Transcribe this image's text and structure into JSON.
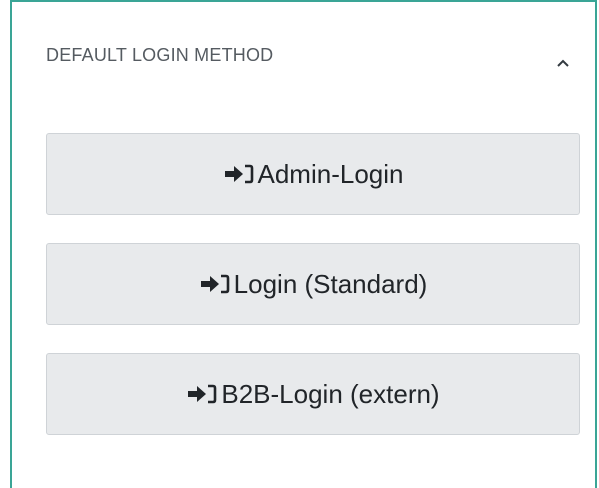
{
  "panel": {
    "title": "DEFAULT LOGIN METHOD",
    "toggle_icon": "chevron-up-icon",
    "accent_color": "#3aa596"
  },
  "login_buttons": [
    {
      "label": "Admin-Login",
      "icon": "sign-in-icon"
    },
    {
      "label": "Login (Standard)",
      "icon": "sign-in-icon"
    },
    {
      "label": "B2B-Login (extern)",
      "icon": "sign-in-icon"
    }
  ],
  "colors": {
    "button_background": "#e8eaec",
    "button_border": "#cfd3d7",
    "button_text": "#212529",
    "title_text": "#555b61"
  }
}
